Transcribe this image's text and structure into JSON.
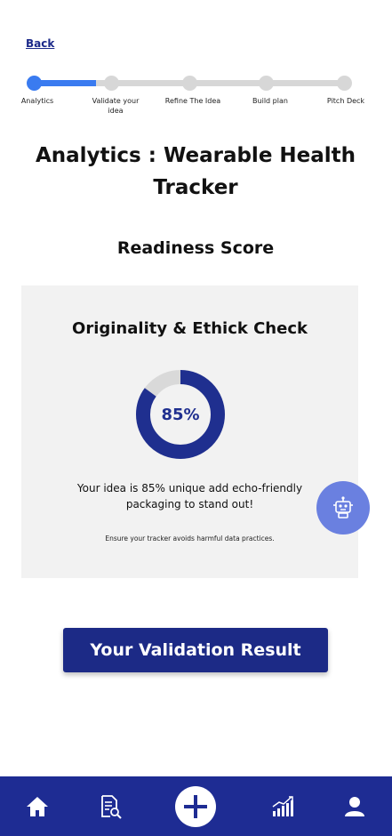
{
  "nav": {
    "back_label": "Back"
  },
  "stepper": {
    "active_index": 0,
    "steps": [
      {
        "label": "Analytics"
      },
      {
        "label": "Validate your idea"
      },
      {
        "label": "Refine The Idea"
      },
      {
        "label": "Build plan"
      },
      {
        "label": "Pitch Deck"
      }
    ]
  },
  "page": {
    "title": "Analytics : Wearable Health Tracker",
    "section_title": "Readiness Score"
  },
  "card": {
    "title": "Originality & Ethick Check",
    "score_percent": 85,
    "score_label": "85%",
    "message": "Your idea is 85% unique add echo-friendly packaging to stand out!",
    "note": "Ensure your tracker avoids harmful data practices."
  },
  "assistant": {
    "icon": "robot-icon"
  },
  "cta": {
    "label": "Your Validation Result"
  },
  "bottom_nav": {
    "items": [
      {
        "icon": "home-icon"
      },
      {
        "icon": "document-search-icon"
      },
      {
        "icon": "plus-icon"
      },
      {
        "icon": "growth-chart-icon"
      },
      {
        "icon": "user-icon"
      }
    ]
  },
  "colors": {
    "accent": "#3a7bf0",
    "primary": "#1c2a86",
    "donut_fill": "#1f2f8f",
    "donut_track": "#d9d9d9",
    "robot_bg": "#6a80e0"
  }
}
